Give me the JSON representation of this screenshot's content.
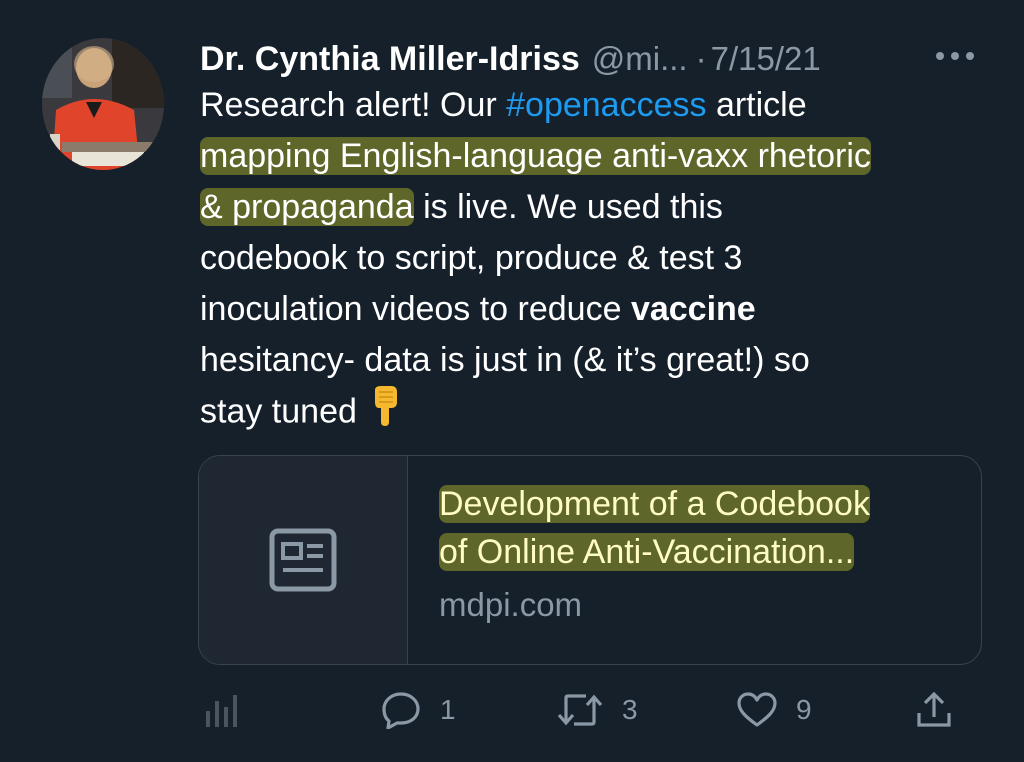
{
  "tweet": {
    "author_name": "Dr. Cynthia Miller-Idriss",
    "handle": "@mi...",
    "separator": "·",
    "date": "7/15/21",
    "text": {
      "line1_pre": "Research alert! Our ",
      "hashtag": "#openaccess",
      "line1_post": " article",
      "highlight_a": "mapping English-language anti-vaxx rhetoric",
      "highlight_b": "& propaganda",
      "line3_post": " is live. We used this",
      "line4": "codebook to script, produce & test 3",
      "line5_pre": "inoculation videos to reduce ",
      "line5_bold": "vaccine",
      "line6": "hesitancy- data is just in (& it’s great!) so",
      "line7": "stay tuned"
    },
    "emoji_icon": "backhand-index-pointing-down-icon"
  },
  "link_card": {
    "title_line1": "Development of a Codebook",
    "title_line2": "of Online Anti-Vaccination...",
    "domain": "mdpi.com",
    "thumb_icon": "article-icon"
  },
  "actions": {
    "analytics_icon": "analytics-icon",
    "reply_count": "1",
    "retweet_count": "3",
    "like_count": "9",
    "share_icon": "share-icon"
  },
  "colors": {
    "background": "#15202b",
    "accent": "#1d9bf0",
    "muted": "#8b98a5",
    "highlight": "#d6de28"
  }
}
